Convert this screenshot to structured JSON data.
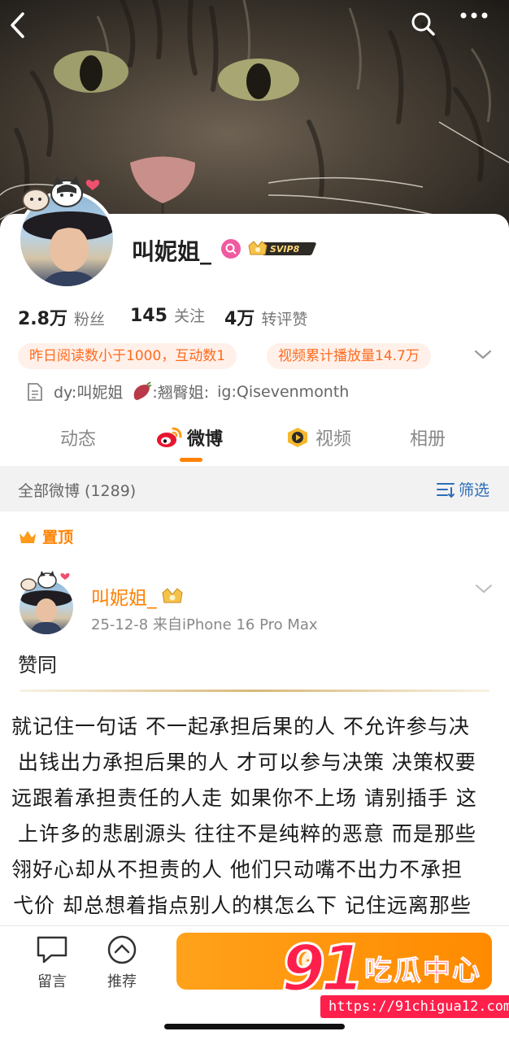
{
  "profile": {
    "name": "叫妮姐_",
    "svip_label": "SVIP8",
    "stats": [
      {
        "value": "2.8万",
        "label": "粉丝"
      },
      {
        "value": "145",
        "label": "关注"
      },
      {
        "value": "4万",
        "label": "转评赞"
      }
    ],
    "tags": [
      "昨日阅读数小于1000，互动数1",
      "视频累计播放量14.7万"
    ],
    "bio": {
      "part1": "dy:叫妮姐",
      "part2": ":翘臀姐:",
      "part3": "ig:Qisevenmonth"
    }
  },
  "tabs": [
    "动态",
    "微博",
    "视频",
    "相册"
  ],
  "filter": {
    "all_posts": "全部微博 (1289)",
    "filter_label": "筛选"
  },
  "post": {
    "pinned_label": "置顶",
    "author": "叫妮姐_",
    "meta": "25-12-8  来自iPhone 16 Pro Max",
    "text": "赞同",
    "image_lines": [
      "就记住一句话 不一起承担后果的人 不允许参与决",
      "出钱出力承担后果的人 才可以参与决策 决策权要",
      "远跟着承担责任的人走 如果你不上场 请别插手 这",
      "上许多的悲剧源头 往往不是纯粹的恶意 而是那些",
      "翎好心却从不担责的人 他们只动嘴不出力不承担",
      "弋价 却总想着指点别人的棋怎么下 记住远离那些"
    ]
  },
  "bottom_bar": {
    "comment": "留言",
    "recommend": "推荐",
    "follow_icon": "+"
  },
  "watermark": {
    "number": "91",
    "name": "吃瓜中心",
    "url": "https://91chigua12.com"
  },
  "colors": {
    "accent": "#ff8200",
    "link_blue": "#2c6db8",
    "tag_bg": "#fff1ea",
    "watermark_red": "#ff1f4b"
  }
}
